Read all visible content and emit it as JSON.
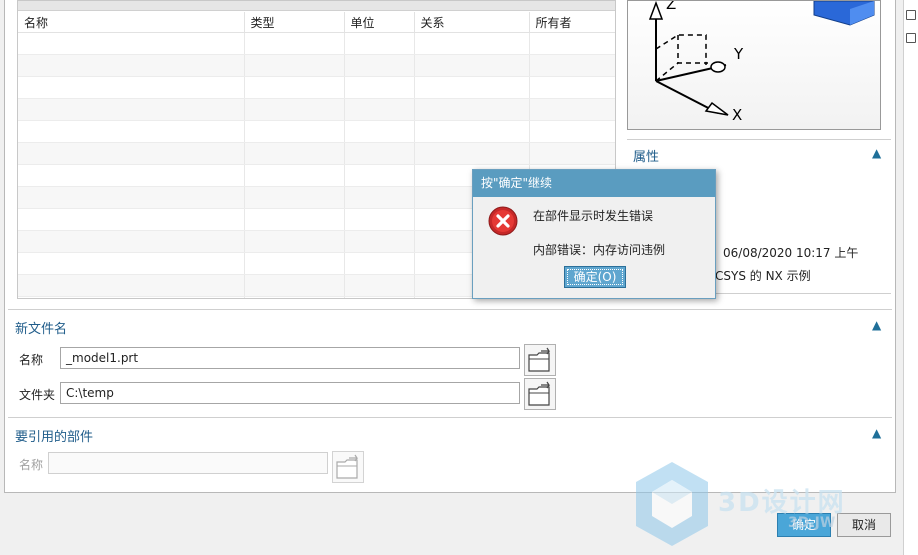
{
  "table": {
    "columns": [
      "名称",
      "类型",
      "单位",
      "关系",
      "所有者"
    ],
    "empty_rows": 13
  },
  "properties": {
    "title": "属性",
    "date_value": "06/08/2020 10:17 上午",
    "desc_value": "CSYS 的 NX 示例"
  },
  "preview": {
    "axis_x": "X",
    "axis_y": "Y",
    "axis_z": "Z"
  },
  "new_file": {
    "title": "新文件名",
    "name_label": "名称",
    "name_value": "_model1.prt",
    "folder_label": "文件夹",
    "folder_value": "C:\\temp"
  },
  "referenced_part": {
    "title": "要引用的部件",
    "name_label": "名称",
    "name_value": ""
  },
  "footer": {
    "ok_label": "确定",
    "cancel_label": "取消"
  },
  "error_dialog": {
    "title": "按\"确定\"继续",
    "message": "在部件显示时发生错误",
    "detail": "内部错误：内存访问违例",
    "ok_label": "确定(O)"
  },
  "watermark": {
    "text": "3D设计网",
    "url_text": "3D.JW"
  },
  "colors": {
    "accent": "#1f5c8a",
    "dialog_title": "#5a9cc0",
    "error": "#d32f2f"
  }
}
